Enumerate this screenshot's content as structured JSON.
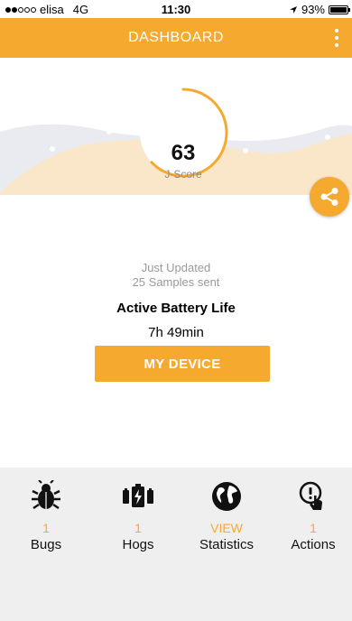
{
  "status_bar": {
    "carrier": "elisa",
    "network": "4G",
    "time": "11:30",
    "battery_percent": "93%",
    "signal_bars_filled": 2,
    "signal_bars_total": 5
  },
  "app_bar": {
    "title": "DASHBOARD",
    "menu_icon": "more-vertical-icon"
  },
  "score": {
    "value": "63",
    "label": "J-Score",
    "gauge_fraction": 0.63
  },
  "share_icon": "share-icon",
  "status": {
    "updated": "Just Updated",
    "samples": "25 Samples sent"
  },
  "battery_life": {
    "title": "Active Battery Life",
    "value": "7h 49min"
  },
  "my_device_button": "MY DEVICE",
  "bottom_tabs": [
    {
      "icon": "bug-icon",
      "count": "1",
      "label": "Bugs"
    },
    {
      "icon": "battery-hog-icon",
      "count": "1",
      "label": "Hogs"
    },
    {
      "icon": "globe-icon",
      "count": "VIEW",
      "label": "Statistics"
    },
    {
      "icon": "touch-action-icon",
      "count": "1",
      "label": "Actions"
    }
  ],
  "colors": {
    "accent": "#F5AA2F",
    "wave_orange": "#FCE6C4",
    "wave_grey": "#E3E6EC",
    "tab_bar_bg": "#EFEFF0"
  }
}
